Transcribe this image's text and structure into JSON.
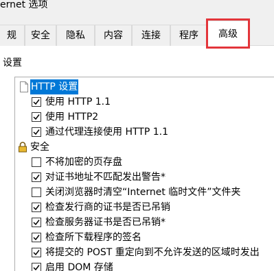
{
  "window": {
    "title": "ernet 选项"
  },
  "tabs": [
    {
      "label": "规"
    },
    {
      "label": "安全"
    },
    {
      "label": "隐私"
    },
    {
      "label": "内容"
    },
    {
      "label": "连接"
    },
    {
      "label": "程序"
    },
    {
      "label": "高级"
    }
  ],
  "settings": {
    "group_label": "设置",
    "items": [
      {
        "label": "HTTP 设置",
        "kind": "category",
        "icon": "page-icon"
      },
      {
        "label": "使用 HTTP 1.1",
        "kind": "checkbox",
        "checked": true
      },
      {
        "label": "使用 HTTP2",
        "kind": "checkbox",
        "checked": true
      },
      {
        "label": "通过代理连接使用 HTTP 1.1",
        "kind": "checkbox",
        "checked": true
      },
      {
        "label": "安全",
        "kind": "category",
        "icon": "lock-icon"
      },
      {
        "label": "不将加密的页存盘",
        "kind": "checkbox",
        "checked": false
      },
      {
        "label": "对证书地址不匹配发出警告*",
        "kind": "checkbox",
        "checked": true
      },
      {
        "label": "关闭浏览器时清空“Internet 临时文件”文件夹",
        "kind": "checkbox",
        "checked": false
      },
      {
        "label": "检查发行商的证书是否已吊销",
        "kind": "checkbox",
        "checked": true
      },
      {
        "label": "检查服务器证书是否已吊销*",
        "kind": "checkbox",
        "checked": true
      },
      {
        "label": "检查所下载程序的签名",
        "kind": "checkbox",
        "checked": true
      },
      {
        "label": "将提交的 POST 重定向到不允许发送的区域时发出",
        "kind": "checkbox",
        "checked": true
      },
      {
        "label": "启用 DOM 存储",
        "kind": "checkbox",
        "checked": true
      }
    ]
  },
  "colors": {
    "highlight": "#e3353a",
    "selection": "#0078d7"
  }
}
